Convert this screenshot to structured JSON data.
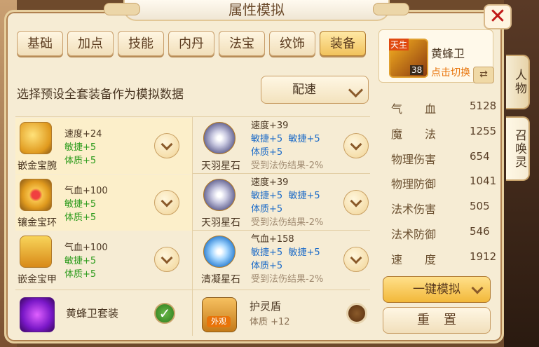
{
  "window": {
    "title": "属性模拟"
  },
  "tabs": [
    {
      "label": "基础"
    },
    {
      "label": "加点"
    },
    {
      "label": "技能"
    },
    {
      "label": "内丹"
    },
    {
      "label": "法宝"
    },
    {
      "label": "纹饰"
    },
    {
      "label": "装备",
      "active": true
    }
  ],
  "preset": {
    "label": "选择预设全套装备作为模拟数据",
    "selected": "配速"
  },
  "equipment_left": [
    {
      "name": "嵌金宝腕",
      "stats": [
        "速度+24",
        "敏捷+5",
        "体质+5"
      ]
    },
    {
      "name": "镶金宝环",
      "stats": [
        "气血+100",
        "敏捷+5",
        "体质+5"
      ]
    },
    {
      "name": "嵌金宝甲",
      "stats": [
        "气血+100",
        "敏捷+5",
        "体质+5"
      ]
    }
  ],
  "equipment_right": [
    {
      "name": "天羽星石",
      "line1": "速度+39",
      "line2a": "敏捷+5",
      "line2b": "敏捷+5",
      "line3": "体质+5",
      "line4": "受到法伤结果-2%"
    },
    {
      "name": "天羽星石",
      "line1": "速度+39",
      "line2a": "敏捷+5",
      "line2b": "敏捷+5",
      "line3": "体质+5",
      "line4": "受到法伤结果-2%"
    },
    {
      "name": "清凝星石",
      "line1": "气血+158",
      "line2a": "敏捷+5",
      "line2b": "敏捷+5",
      "line3": "体质+5",
      "line4": "受到法伤结果-2%"
    }
  ],
  "set_left": {
    "name": "黄蜂卫套装",
    "checked": true
  },
  "set_right": {
    "name": "护灵盾",
    "sub": "体质 +12",
    "badge": "外观",
    "checked": false
  },
  "pet": {
    "name": "黄蜂卫",
    "switch": "点击切换",
    "tag": "天生",
    "level": "38"
  },
  "attributes": [
    {
      "label": "气　　血",
      "value": "5128"
    },
    {
      "label": "魔　　法",
      "value": "1255"
    },
    {
      "label": "物理伤害",
      "value": "654"
    },
    {
      "label": "物理防御",
      "value": "1041"
    },
    {
      "label": "法术伤害",
      "value": "505"
    },
    {
      "label": "法术防御",
      "value": "546"
    },
    {
      "label": "速　　度",
      "value": "1912"
    }
  ],
  "buttons": {
    "simulate": "一键模拟",
    "reset": "重置"
  },
  "side_tabs": [
    {
      "label": "人物"
    },
    {
      "label": "召唤灵"
    }
  ],
  "icons": {
    "close": "close-icon",
    "swap": "swap-icon",
    "check": "check-icon"
  }
}
